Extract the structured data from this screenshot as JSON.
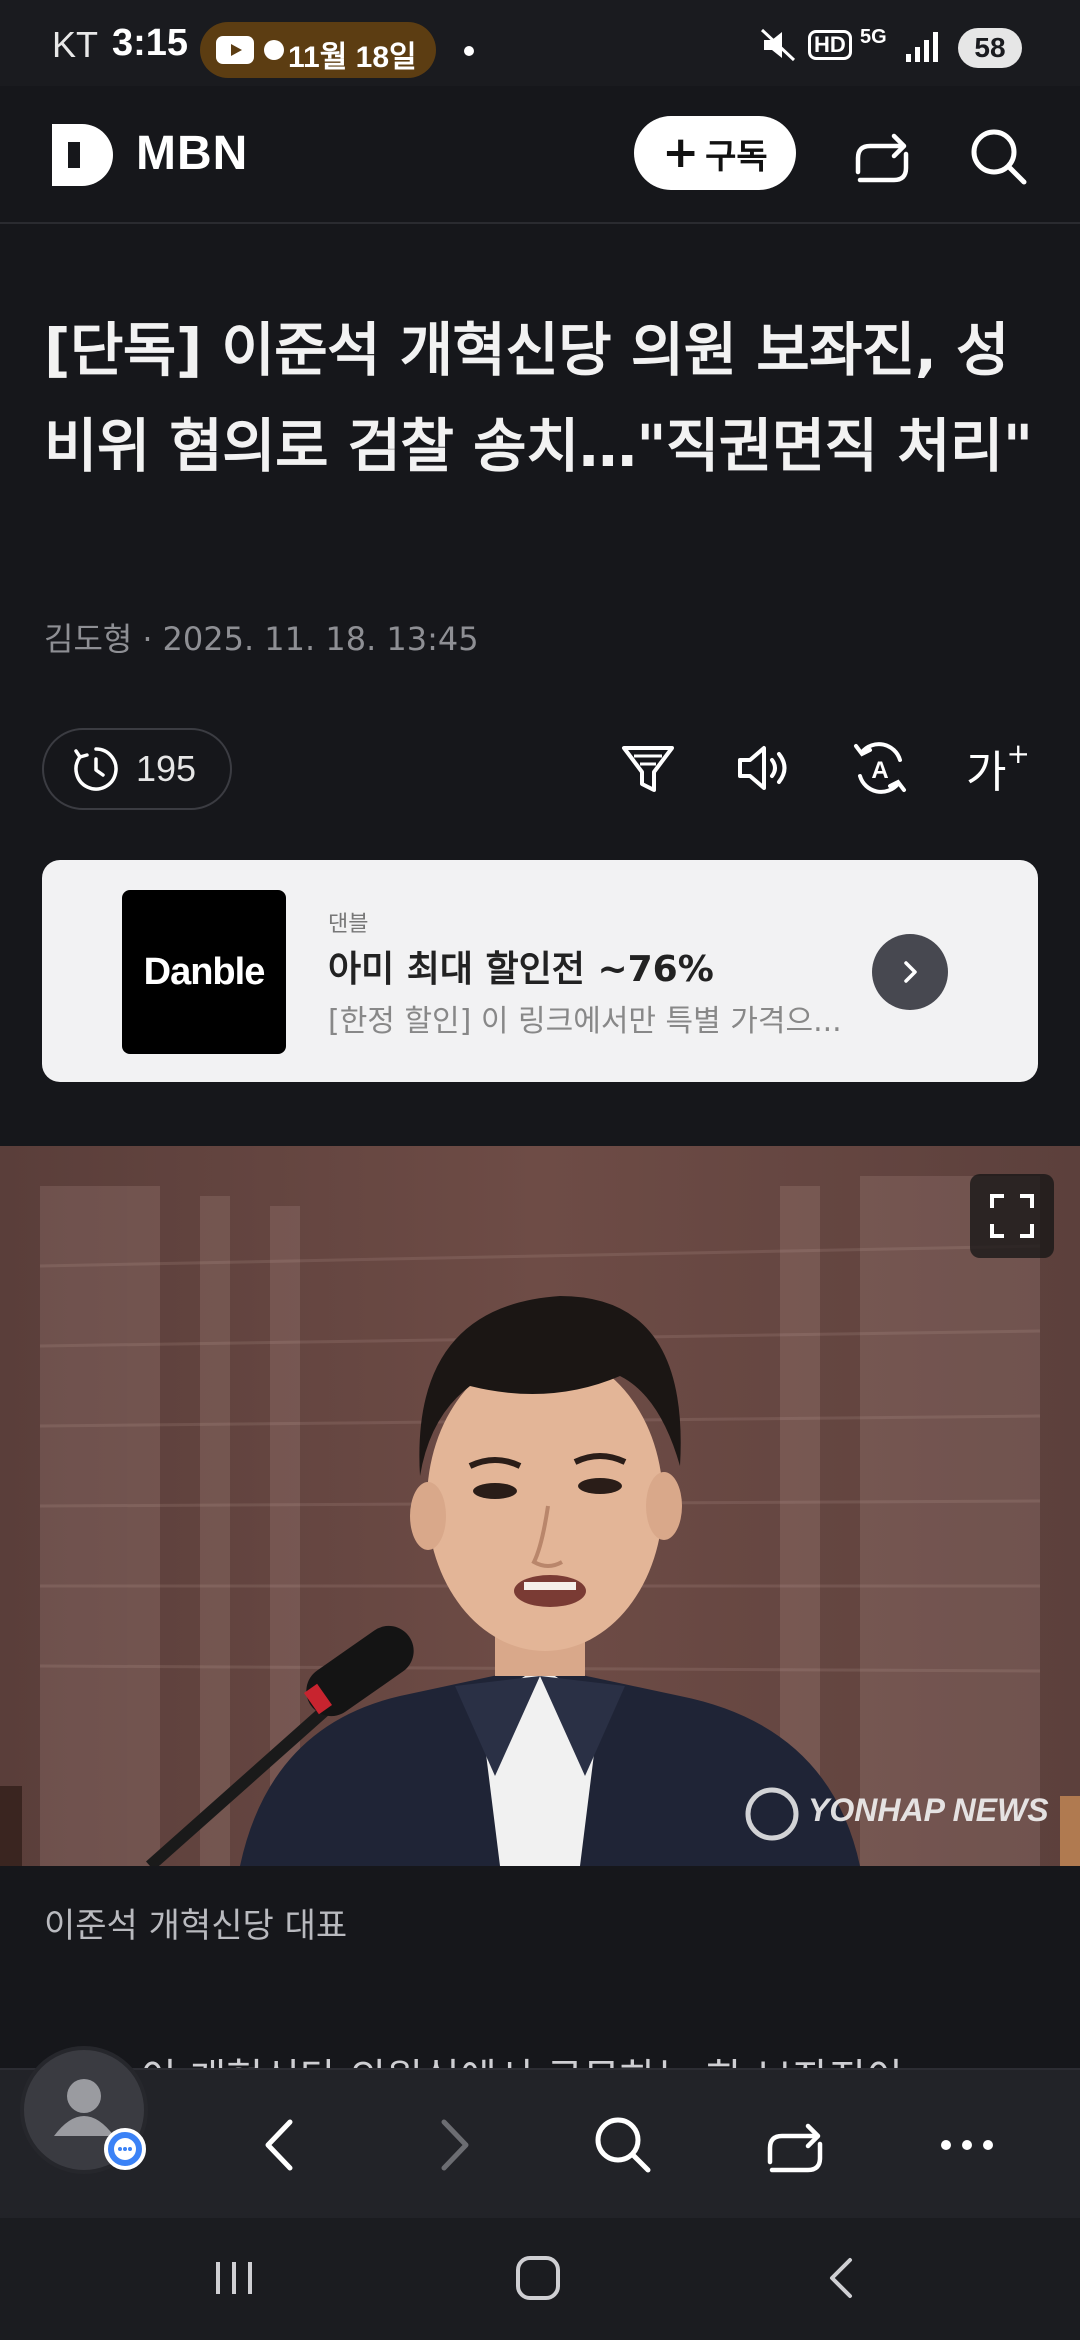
{
  "status_bar": {
    "carrier": "KT",
    "time": "3:15",
    "notification_text": "11월 18일",
    "battery": "58",
    "network": "5G",
    "hd_label": "HD"
  },
  "app_header": {
    "brand": "MBN",
    "subscribe_label": "구독",
    "icons": [
      "mbn-logo-icon",
      "share-icon",
      "search-icon"
    ]
  },
  "article": {
    "headline": "[단독] 이준석 개혁신당 의원 보좌진, 성비위 혐의로 검찰 송치…\"직권면직 처리\"",
    "author": "김도형",
    "datetime": "2025. 11. 18. 13:45",
    "reading_count": "195",
    "font_size_label": "가",
    "tools": [
      "filter-icon",
      "speaker-icon",
      "translate-icon",
      "font-size-icon"
    ],
    "photo_credit": "YONHAP NEWS",
    "caption": "이준석 개혁신당 대표",
    "body_preview": "이 개혁신당 의원실에서 근무하는 한 보좌진이"
  },
  "ad": {
    "logo_text": "Danble",
    "brand": "댄블",
    "title": "아미 최대 할인전 ~76%",
    "description": "[한정 할인] 이 링크에서만 특별 가격으..."
  },
  "browser_bar": {
    "icons": [
      "back-icon",
      "forward-icon",
      "search-icon",
      "share-icon",
      "more-icon"
    ]
  },
  "system_nav": {
    "icons": [
      "recent-apps-icon",
      "home-icon",
      "system-back-icon"
    ]
  },
  "colors": {
    "background": "#16171b",
    "headline": "#f2f2f2",
    "muted": "#8e8f94",
    "ad_card": "#f2f2f3",
    "notification_pill": "#5c3d12"
  }
}
